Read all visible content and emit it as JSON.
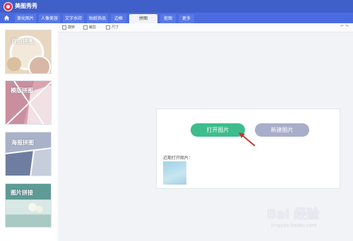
{
  "app": {
    "title": "美图秀秀"
  },
  "tabs": [
    {
      "label": "美化图片",
      "active": false
    },
    {
      "label": "人像美容",
      "active": false
    },
    {
      "label": "文字水印",
      "active": false
    },
    {
      "label": "贴纸饰品",
      "active": false
    },
    {
      "label": "边框",
      "active": false
    },
    {
      "label": "拼图",
      "active": true
    },
    {
      "label": "抠图",
      "active": false
    },
    {
      "label": "更多",
      "active": false
    }
  ],
  "sidebar": {
    "cards": [
      {
        "label": "自由拼图"
      },
      {
        "label": "模版拼图"
      },
      {
        "label": "海报拼图"
      },
      {
        "label": "图片拼接"
      }
    ]
  },
  "toolbar": {
    "rotate": "旋转",
    "crop": "裁剪",
    "size": "尺寸"
  },
  "main": {
    "open_button": "打开图片",
    "new_button": "新建图片",
    "recent_label": "近期打开图片："
  },
  "watermark": {
    "main": "Bai 经验",
    "sub": "jingyan.baidu.com"
  },
  "colors": {
    "titlebar": "#3f5fc9",
    "tabbar": "#4a6be0",
    "open": "#3dbd8c",
    "new": "#a8aec9",
    "arrow": "#c0392b"
  }
}
